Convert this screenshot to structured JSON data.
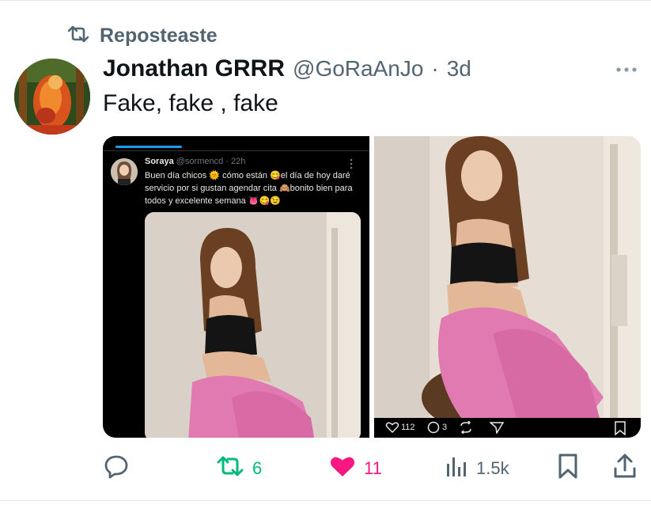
{
  "repost": {
    "label": "Reposteaste"
  },
  "tweet": {
    "author_name": "Jonathan GRRR",
    "handle": "@GoRaAnJo",
    "separator": "·",
    "time": "3d",
    "text": "Fake, fake , fake"
  },
  "embedded_post": {
    "name": "Soraya",
    "handle": "@sormencd",
    "separator": "·",
    "time": "22h",
    "text": "Buen día chicos 🌞 cómo están 😋el día de hoy daré servicio por si gustan agendar cita 🙈bonito bien para todos y excelente semana 👅😋😉"
  },
  "right_image_actions": {
    "likes": "112",
    "replies": "3"
  },
  "actions": {
    "reposts": "6",
    "likes": "11",
    "views": "1.5k"
  },
  "colors": {
    "repost_green": "#00ba7c",
    "like_pink": "#f91880",
    "muted": "#536471"
  },
  "icons": [
    "repost-icon",
    "more-icon",
    "reply-icon",
    "heart-icon",
    "views-icon",
    "bookmark-icon",
    "share-icon"
  ]
}
